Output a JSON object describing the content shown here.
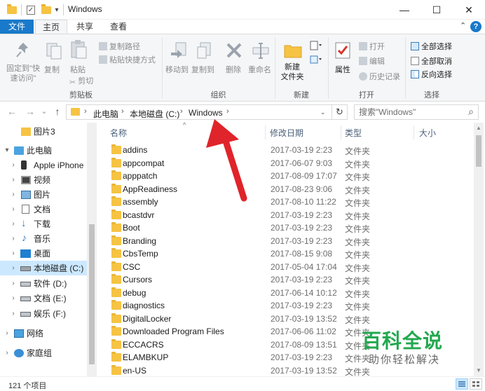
{
  "window": {
    "title": "Windows",
    "minimize_glyph": "—",
    "maximize_glyph": "☐",
    "close_glyph": "✕",
    "quick_access_dropdown": "▾"
  },
  "ribbon_tabs": {
    "file": "文件",
    "home": "主页",
    "share": "共享",
    "view": "查看",
    "collapse_glyph": "⌃",
    "help_glyph": "?"
  },
  "ribbon": {
    "clipboard": {
      "label": "剪贴板",
      "pin_line1": "固定到\"快",
      "pin_line2": "速访问\"",
      "copy": "复制",
      "paste": "粘贴",
      "copy_path": "复制路径",
      "paste_shortcut": "粘贴快捷方式",
      "cut": "剪切"
    },
    "organize": {
      "label": "组织",
      "move_to": "移动到",
      "copy_to": "复制到",
      "delete": "删除",
      "rename": "重命名"
    },
    "new": {
      "label": "新建",
      "new_folder_line1": "新建",
      "new_folder_line2": "文件夹"
    },
    "open": {
      "label": "打开",
      "properties": "属性",
      "open": "打开",
      "edit": "编辑",
      "history": "历史记录"
    },
    "select": {
      "label": "选择",
      "select_all": "全部选择",
      "select_none": "全部取消",
      "invert": "反向选择"
    }
  },
  "address": {
    "back_glyph": "←",
    "forward_glyph": "→",
    "recent_glyph": "⌄",
    "up_glyph": "↑",
    "crumbs": [
      "此电脑",
      "本地磁盘 (C:)",
      "Windows"
    ],
    "crumb_sep": "›",
    "refresh_glyph": "↻",
    "search_placeholder": "搜索\"Windows\"",
    "search_glyph": "⌕"
  },
  "nav_pane": {
    "items": [
      {
        "label": "图片3",
        "icon": "folder-icon"
      },
      {
        "label": "此电脑",
        "icon": "pc-icon"
      },
      {
        "label": "Apple iPhone",
        "icon": "phone-icon"
      },
      {
        "label": "视频",
        "icon": "video-icon"
      },
      {
        "label": "图片",
        "icon": "pictures-icon"
      },
      {
        "label": "文档",
        "icon": "documents-icon"
      },
      {
        "label": "下载",
        "icon": "download-icon"
      },
      {
        "label": "音乐",
        "icon": "music-icon"
      },
      {
        "label": "桌面",
        "icon": "desktop-icon"
      },
      {
        "label": "本地磁盘 (C:)",
        "icon": "drive-icon"
      },
      {
        "label": "软件 (D:)",
        "icon": "drive-icon"
      },
      {
        "label": "文档 (E:)",
        "icon": "drive-icon"
      },
      {
        "label": "娱乐 (F:)",
        "icon": "drive-icon"
      },
      {
        "label": "网络",
        "icon": "network-icon"
      },
      {
        "label": "家庭组",
        "icon": "homegroup-icon"
      }
    ]
  },
  "columns": {
    "name": "名称",
    "modified": "修改日期",
    "type": "类型",
    "size": "大小",
    "sort_glyph": "^"
  },
  "files": [
    {
      "name": "addins",
      "modified": "2017-03-19 2:23",
      "type": "文件夹"
    },
    {
      "name": "appcompat",
      "modified": "2017-06-07 9:03",
      "type": "文件夹"
    },
    {
      "name": "apppatch",
      "modified": "2017-08-09 17:07",
      "type": "文件夹"
    },
    {
      "name": "AppReadiness",
      "modified": "2017-08-23 9:06",
      "type": "文件夹"
    },
    {
      "name": "assembly",
      "modified": "2017-08-10 11:22",
      "type": "文件夹"
    },
    {
      "name": "bcastdvr",
      "modified": "2017-03-19 2:23",
      "type": "文件夹"
    },
    {
      "name": "Boot",
      "modified": "2017-03-19 2:23",
      "type": "文件夹"
    },
    {
      "name": "Branding",
      "modified": "2017-03-19 2:23",
      "type": "文件夹"
    },
    {
      "name": "CbsTemp",
      "modified": "2017-08-15 9:08",
      "type": "文件夹"
    },
    {
      "name": "CSC",
      "modified": "2017-05-04 17:04",
      "type": "文件夹"
    },
    {
      "name": "Cursors",
      "modified": "2017-03-19 2:23",
      "type": "文件夹"
    },
    {
      "name": "debug",
      "modified": "2017-06-14 10:12",
      "type": "文件夹"
    },
    {
      "name": "diagnostics",
      "modified": "2017-03-19 2:23",
      "type": "文件夹"
    },
    {
      "name": "DigitalLocker",
      "modified": "2017-03-19 13:52",
      "type": "文件夹"
    },
    {
      "name": "Downloaded Program Files",
      "modified": "2017-06-06 11:02",
      "type": "文件夹"
    },
    {
      "name": "ECCACRS",
      "modified": "2017-08-09 13:51",
      "type": "文件夹"
    },
    {
      "name": "ELAMBKUP",
      "modified": "2017-03-19 2:23",
      "type": "文件夹"
    },
    {
      "name": "en-US",
      "modified": "2017-03-19 13:52",
      "type": "文件夹"
    }
  ],
  "status": {
    "item_count": "121 个项目"
  },
  "watermark": {
    "logo": "百科全说",
    "subtitle": "助你轻松解决"
  },
  "colors": {
    "accent": "#1979ca",
    "folder": "#f6c343",
    "annotation_arrow": "#e0242b",
    "watermark": "#22a84f"
  }
}
